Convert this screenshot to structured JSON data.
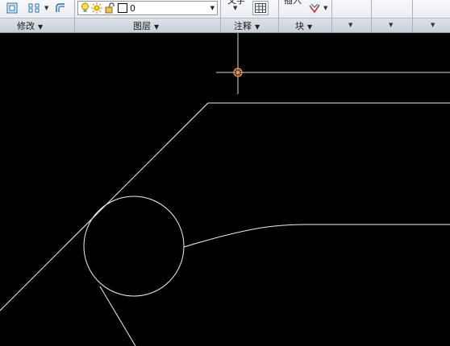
{
  "ribbon": {
    "panels": {
      "modify": {
        "title": "修改"
      },
      "layers": {
        "title": "图层",
        "current_layer": "0"
      },
      "annotation": {
        "title": "注释",
        "text_label": "文字"
      },
      "block": {
        "title": "块",
        "insert_label": "插入"
      }
    }
  },
  "colors": {
    "ribbon_bg": "#e8ebef",
    "canvas_bg": "#000000",
    "line": "#ffffff",
    "crosshair_center": "#ff9a3c"
  },
  "icons": [
    "stretch-icon",
    "array-icon",
    "offset-icon",
    "light-bulb-icon",
    "sun-icon",
    "unlock-icon",
    "color-swatch-icon",
    "table-icon",
    "block-editor-icon"
  ]
}
